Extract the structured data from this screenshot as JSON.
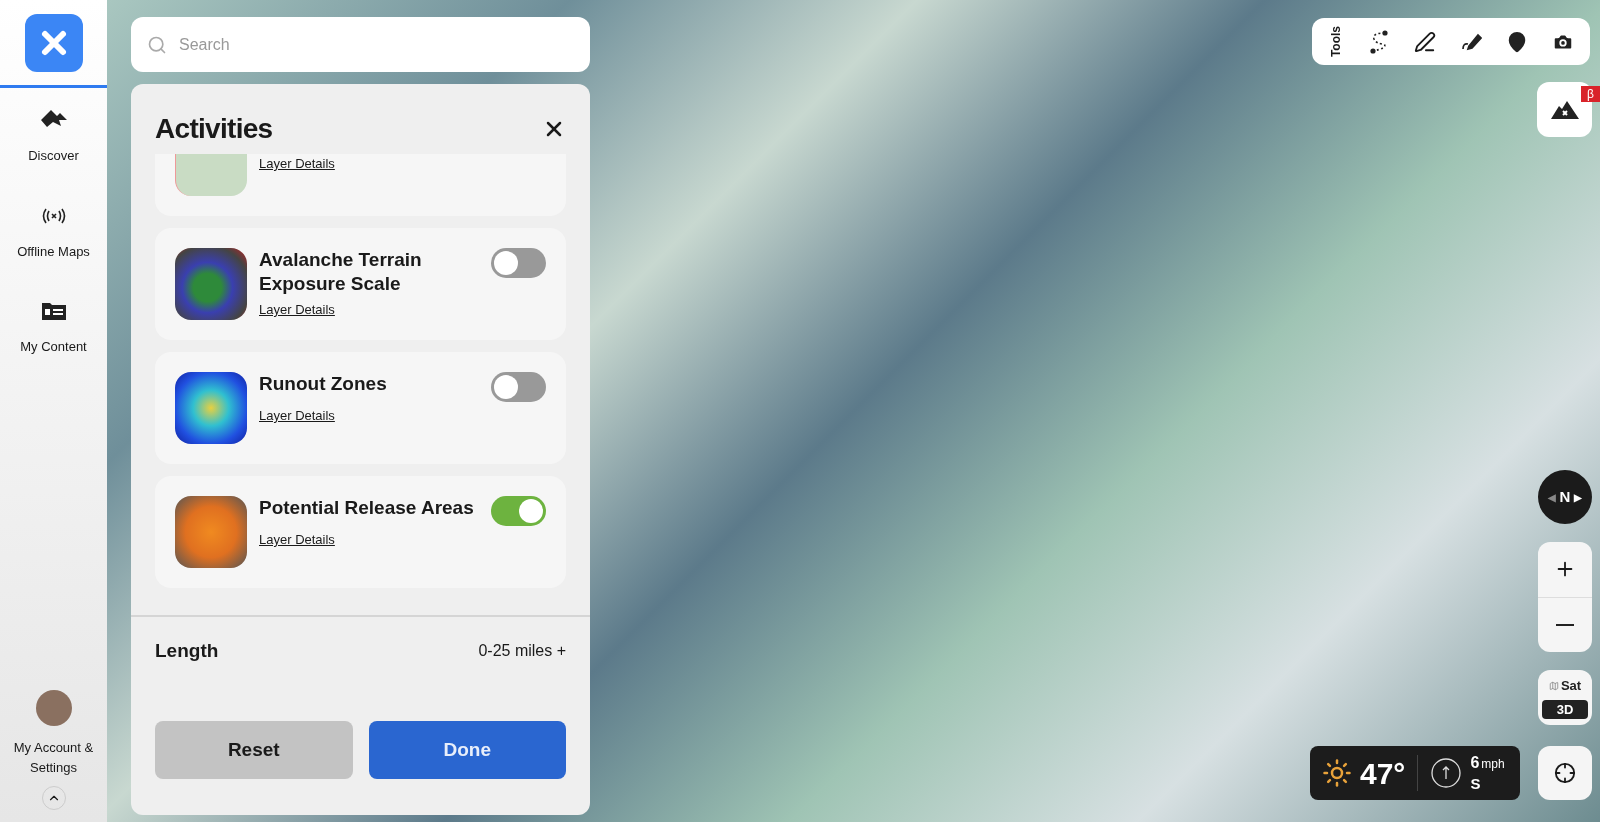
{
  "sidebar": {
    "items": [
      {
        "label": "Discover",
        "selected": false
      },
      {
        "label": "Offline Maps",
        "selected": false
      },
      {
        "label": "My Content",
        "selected": false
      }
    ],
    "account": {
      "label": "My Account & Settings"
    }
  },
  "search": {
    "placeholder": "Search"
  },
  "panel": {
    "title": "Activities",
    "layers": [
      {
        "kind": "partial",
        "link": "Layer Details"
      },
      {
        "kind": "layer",
        "name": "Avalanche Terrain Exposure Scale",
        "link": "Layer Details",
        "on": false
      },
      {
        "kind": "layer",
        "name": "Runout Zones",
        "link": "Layer Details",
        "on": false
      },
      {
        "kind": "layer",
        "name": "Potential Release Areas",
        "link": "Layer Details",
        "on": true
      }
    ],
    "filter": {
      "label": "Length",
      "value": "0-25 miles +"
    },
    "buttons": [
      {
        "label": "Reset",
        "kind": "secondary"
      },
      {
        "label": "Done",
        "kind": "primary"
      }
    ]
  },
  "toolbar": {
    "label": "Tools"
  },
  "beta_badge": "β",
  "compass": {
    "left": "◀",
    "label": "N",
    "right": "▶"
  },
  "map_mode": [
    {
      "label": "Sat",
      "selected": false
    },
    {
      "label": "3D",
      "selected": true
    }
  ],
  "weather": {
    "temperature": "47°",
    "wind_speed": "6",
    "wind_unit": "mph",
    "wind_direction": "S"
  }
}
